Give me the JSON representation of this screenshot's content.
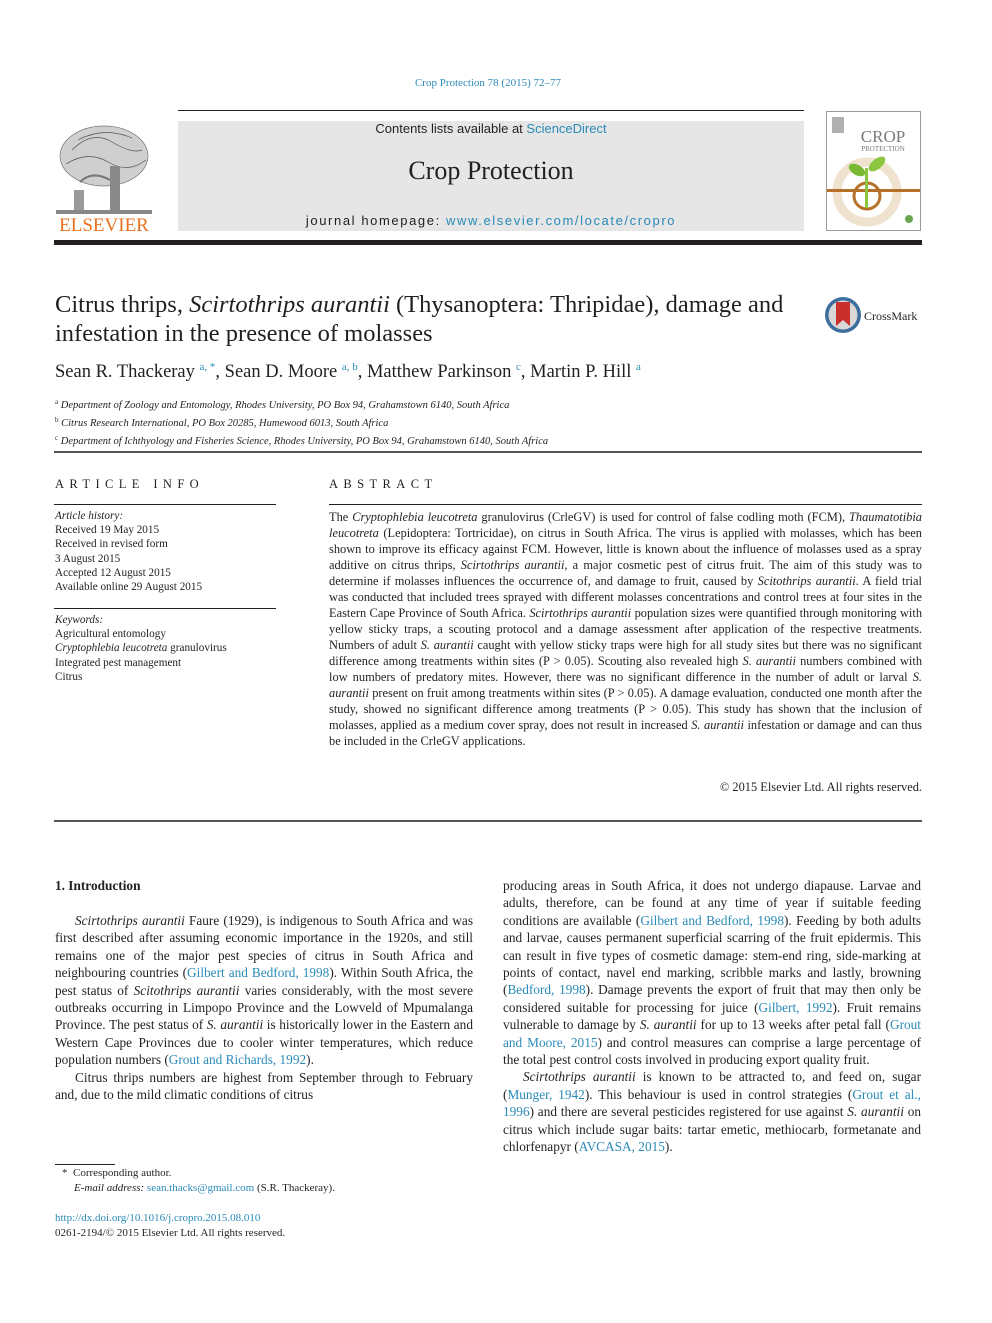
{
  "header": {
    "journal_ref": "Crop Protection 78 (2015) 72–77",
    "contents_prefix": "Contents lists available at ",
    "contents_link": "ScienceDirect",
    "journal_title": "Crop Protection",
    "homepage_prefix": "journal homepage: ",
    "homepage_link": "www.elsevier.com/locate/cropro",
    "publisher_logo_text": "ELSEVIER",
    "cover_title_line1": "CROP",
    "cover_title_line2": "PROTECTION",
    "crossmark_label": "CrossMark"
  },
  "article": {
    "title_part1": "Citrus thrips, ",
    "title_species": "Scirtothrips aurantii",
    "title_part2": " (Thysanoptera: Thripidae), damage and infestation in the presence of molasses",
    "authors": [
      {
        "name": "Sean R. Thackeray",
        "sup": "a, *",
        "sep": ", "
      },
      {
        "name": "Sean D. Moore",
        "sup": "a, b",
        "sep": ", "
      },
      {
        "name": "Matthew Parkinson",
        "sup": "c",
        "sep": ", "
      },
      {
        "name": "Martin P. Hill",
        "sup": "a",
        "sep": ""
      }
    ],
    "affiliations": [
      {
        "key": "a",
        "text": "Department of Zoology and Entomology, Rhodes University, PO Box 94, Grahamstown 6140, South Africa"
      },
      {
        "key": "b",
        "text": "Citrus Research International, PO Box 20285, Humewood 6013, South Africa"
      },
      {
        "key": "c",
        "text": "Department of Ichthyology and Fisheries Science, Rhodes University, PO Box 94, Grahamstown 6140, South Africa"
      }
    ]
  },
  "article_info": {
    "heading": "ARTICLE INFO",
    "history_label": "Article history:",
    "history": [
      "Received 19 May 2015",
      "Received in revised form",
      "3 August 2015",
      "Accepted 12 August 2015",
      "Available online 29 August 2015"
    ],
    "keywords_label": "Keywords:",
    "keywords": {
      "k1": "Agricultural entomology",
      "k2_italic": "Cryptophlebia leucotreta",
      "k2_rest": " granulovirus",
      "k3": "Integrated pest management",
      "k4": "Citrus"
    }
  },
  "abstract": {
    "heading": "ABSTRACT",
    "segments": [
      {
        "t": "The ",
        "i": false
      },
      {
        "t": "Cryptophlebia leucotreta",
        "i": true
      },
      {
        "t": " granulovirus (CrleGV) is used for control of false codling moth (FCM), ",
        "i": false
      },
      {
        "t": "Thaumatotibia leucotreta",
        "i": true
      },
      {
        "t": " (Lepidoptera: Tortricidae), on citrus in South Africa. The virus is applied with molasses, which has been shown to improve its efficacy against FCM. However, little is known about the influence of molasses used as a spray additive on citrus thrips, ",
        "i": false
      },
      {
        "t": "Scirtothrips aurantii",
        "i": true
      },
      {
        "t": ", a major cosmetic pest of citrus fruit. The aim of this study was to determine if molasses influences the occurrence of, and damage to fruit, caused by ",
        "i": false
      },
      {
        "t": "Scitothrips aurantii",
        "i": true
      },
      {
        "t": ". A field trial was conducted that included trees sprayed with different molasses concentrations and control trees at four sites in the Eastern Cape Province of South Africa. ",
        "i": false
      },
      {
        "t": "Scirtothrips aurantii",
        "i": true
      },
      {
        "t": " population sizes were quantified through monitoring with yellow sticky traps, a scouting protocol and a damage assessment after application of the respective treatments. Numbers of adult ",
        "i": false
      },
      {
        "t": "S. aurantii",
        "i": true
      },
      {
        "t": " caught with yellow sticky traps were high for all study sites but there was no significant difference among treatments within sites (P > 0.05). Scouting also revealed high ",
        "i": false
      },
      {
        "t": "S. aurantii",
        "i": true
      },
      {
        "t": " numbers combined with low numbers of predatory mites. However, there was no significant difference in the number of adult or larval ",
        "i": false
      },
      {
        "t": "S. aurantii",
        "i": true
      },
      {
        "t": " present on fruit among treatments within sites (P > 0.05). A damage evaluation, conducted one month after the study, showed no significant difference among treatments (P > 0.05). This study has shown that the inclusion of molasses, applied as a medium cover spray, does not result in increased ",
        "i": false
      },
      {
        "t": "S. aurantii",
        "i": true
      },
      {
        "t": " infestation or damage and can thus be included in the CrleGV applications.",
        "i": false
      }
    ],
    "copyright": "© 2015 Elsevier Ltd. All rights reserved."
  },
  "body": {
    "section_heading": "1.  Introduction",
    "left_paragraphs": [
      [
        {
          "t": "Scirtothrips aurantii",
          "s": "i"
        },
        {
          "t": " Faure (1929), is indigenous to South Africa and was first described after assuming economic importance in the 1920s, and still remains one of the major pest species of citrus in South Africa and neighbouring countries (",
          "s": ""
        },
        {
          "t": "Gilbert and Bedford, 1998",
          "s": "link"
        },
        {
          "t": "). Within South Africa, the pest status of ",
          "s": ""
        },
        {
          "t": "Scitothrips aurantii",
          "s": "i"
        },
        {
          "t": " varies considerably, with the most severe outbreaks occurring in Limpopo Province and the Lowveld of Mpumalanga Province. The pest status of ",
          "s": ""
        },
        {
          "t": "S. aurantii",
          "s": "i"
        },
        {
          "t": " is historically lower in the Eastern and Western Cape Provinces due to cooler winter temperatures, which reduce population numbers (",
          "s": ""
        },
        {
          "t": "Grout and Richards, 1992",
          "s": "link"
        },
        {
          "t": ").",
          "s": ""
        }
      ],
      [
        {
          "t": "Citrus thrips numbers are highest from September through to February and, due to the mild climatic conditions of citrus",
          "s": ""
        }
      ]
    ],
    "right_paragraphs": [
      [
        {
          "t": "producing areas in South Africa, it does not undergo diapause. Larvae and adults, therefore, can be found at any time of year if suitable feeding conditions are available (",
          "s": ""
        },
        {
          "t": "Gilbert and Bedford, 1998",
          "s": "link"
        },
        {
          "t": "). Feeding by both adults and larvae, causes permanent su­perficial scarring of the fruit epidermis. This can result in five types of cosmetic damage: stem-end ring, side-marking at points of contact, navel end marking, scribble marks and lastly, browning (",
          "s": ""
        },
        {
          "t": "Bedford, 1998",
          "s": "link"
        },
        {
          "t": "). Damage prevents the export of fruit that may then only be considered suitable for processing for juice (",
          "s": ""
        },
        {
          "t": "Gilbert, 1992",
          "s": "link"
        },
        {
          "t": "). Fruit remains vulnerable to damage by ",
          "s": ""
        },
        {
          "t": "S. aurantii",
          "s": "i"
        },
        {
          "t": " for up to 13 weeks after petal fall (",
          "s": ""
        },
        {
          "t": "Grout and Moore, 2015",
          "s": "link"
        },
        {
          "t": ") and control measures can comprise a large percentage of the total pest control costs involved in producing export quality fruit.",
          "s": ""
        }
      ],
      [
        {
          "t": "Scirtothrips aurantii",
          "s": "i"
        },
        {
          "t": " is known to be attracted to, and feed on, sugar (",
          "s": ""
        },
        {
          "t": "Munger, 1942",
          "s": "link"
        },
        {
          "t": "). This behaviour is used in control strategies (",
          "s": ""
        },
        {
          "t": "Grout et al., 1996",
          "s": "link"
        },
        {
          "t": ") and there are several pesticides registered for use against ",
          "s": ""
        },
        {
          "t": "S. aurantii",
          "s": "i"
        },
        {
          "t": " on citrus which include sugar baits: tartar emetic, methiocarb, formetanate and chlorfenapyr (",
          "s": ""
        },
        {
          "t": "AVCASA, 2015",
          "s": "link"
        },
        {
          "t": ").",
          "s": ""
        }
      ]
    ]
  },
  "footnotes": {
    "corresponding_mark": "*",
    "corresponding_text": "Corresponding author.",
    "email_label": "E-mail address: ",
    "email": "sean.thacks@gmail.com",
    "email_suffix": " (S.R. Thackeray).",
    "doi": "http://dx.doi.org/10.1016/j.cropro.2015.08.010",
    "issn_copyright": "0261-2194/© 2015 Elsevier Ltd. All rights reserved."
  },
  "colors": {
    "link": "#2a8ab8",
    "elsevier_orange": "#e9711c",
    "banner_gray": "#e6e6e6",
    "text": "#231f20"
  }
}
